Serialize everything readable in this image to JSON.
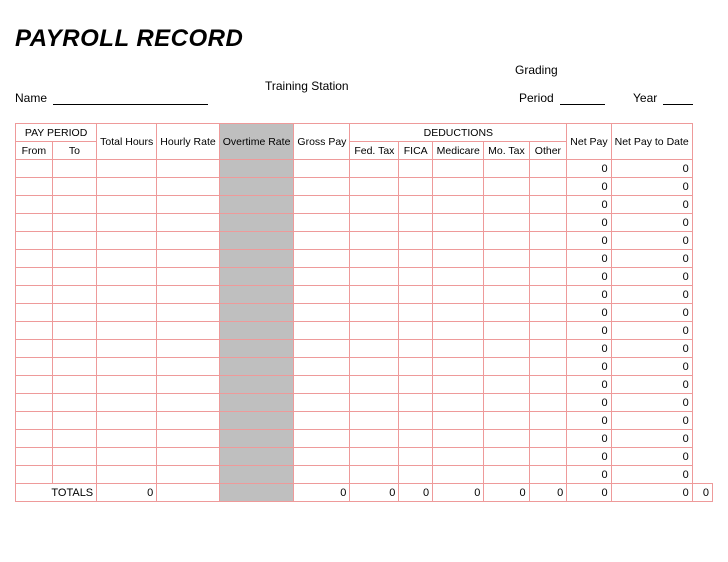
{
  "title": "PAYROLL RECORD",
  "labels": {
    "name": "Name",
    "training": "Training Station",
    "grading": "Grading",
    "period": "Period",
    "year": "Year",
    "totals": "TOTALS"
  },
  "header": {
    "pay_period": "PAY PERIOD",
    "from": "From",
    "to": "To",
    "total_hours": "Total Hours",
    "hourly_rate": "Hourly Rate",
    "overtime_rate": "Overtime Rate",
    "gross_pay": "Gross Pay",
    "deductions": "DEDUCTIONS",
    "fed_tax": "Fed. Tax",
    "fica": "FICA",
    "medicare": "Medicare",
    "mo_tax": "Mo. Tax",
    "other": "Other",
    "net_pay": "Net Pay",
    "net_pay_to_date": "Net Pay to Date"
  },
  "row_count": 18,
  "defaults": {
    "net_pay": "0",
    "net_pay_to_date": "0"
  },
  "totals": {
    "total_hours": "0",
    "gross_pay": "0",
    "fed_tax": "0",
    "fica": "0",
    "medicare": "0",
    "mo_tax": "0",
    "other": "0",
    "net_pay": "0",
    "net_pay_to_date": "0",
    "extra": "0"
  }
}
